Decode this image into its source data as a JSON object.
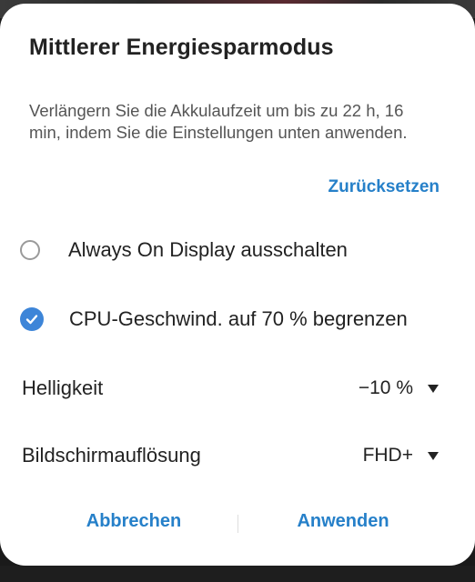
{
  "dialog": {
    "title": "Mittlerer Energiesparmodus",
    "description": "Verlängern Sie die Akkulaufzeit um bis zu 22 h, 16 min, indem Sie die Einstellungen unten anwenden.",
    "reset_label": "Zurücksetzen"
  },
  "options": [
    {
      "label": "Always On Display ausschalten",
      "checked": false
    },
    {
      "label": "CPU-Geschwind. auf 70 % begrenzen",
      "checked": true
    }
  ],
  "settings": [
    {
      "label": "Helligkeit",
      "value": "−10 %"
    },
    {
      "label": "Bildschirmauflösung",
      "value": "FHD+"
    }
  ],
  "footer": {
    "cancel_label": "Abbrechen",
    "apply_label": "Anwenden"
  },
  "colors": {
    "accent": "#2680c9",
    "checkbox": "#3d85d8"
  },
  "icons": {
    "radio_unchecked": "radio-unchecked-icon",
    "radio_checked": "check-circle-icon",
    "dropdown": "triangle-down-icon"
  }
}
